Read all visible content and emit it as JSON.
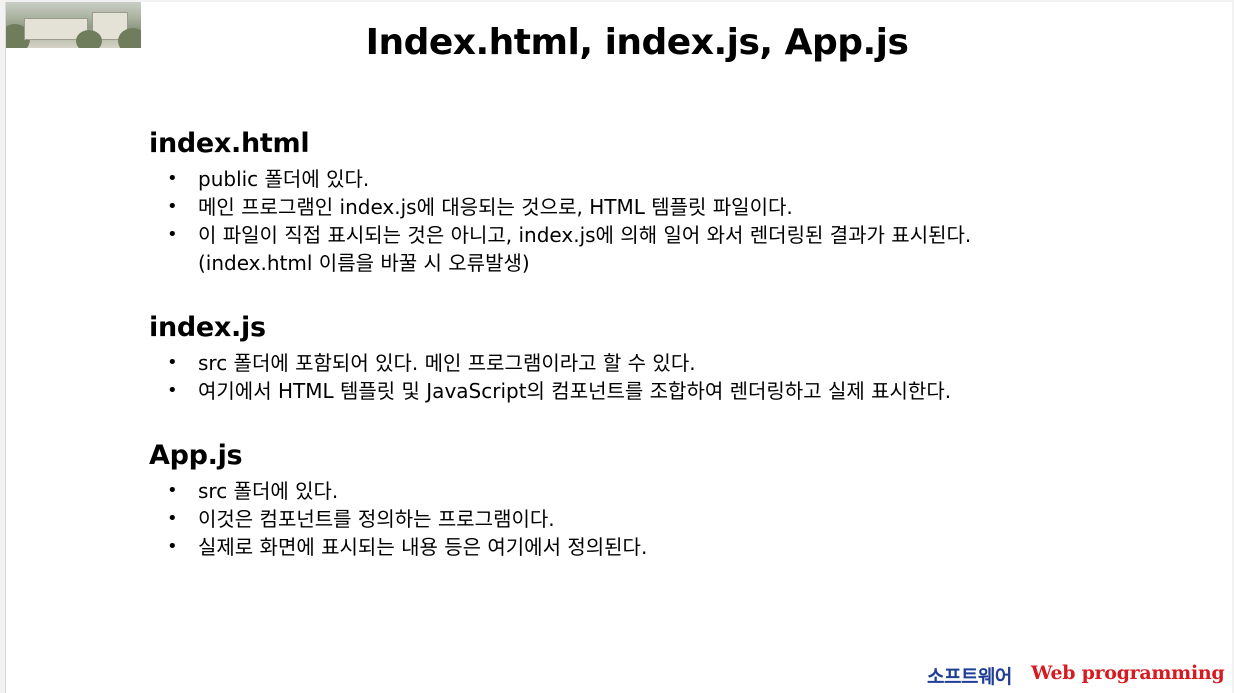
{
  "title": "Index.html, index.js, App.js",
  "sections": [
    {
      "heading": "index.html",
      "items": [
        "public 폴더에 있다.",
        "메인 프로그램인 index.js에 대응되는 것으로, HTML 템플릿 파일이다.",
        "이 파일이 직접 표시되는 것은 아니고, index.js에 의해 일어 와서 렌더링된 결과가 표시된다."
      ],
      "item3_continuation": "(index.html 이름을 바꿀 시 오류발생)"
    },
    {
      "heading": "index.js",
      "items": [
        "src 폴더에 포함되어 있다. 메인 프로그램이라고 할 수 있다.",
        "여기에서 HTML 템플릿 및 JavaScript의 컴포넌트를 조합하여 렌더링하고 실제 표시한다."
      ]
    },
    {
      "heading": "App.js",
      "items": [
        "src 폴더에 있다.",
        "이것은 컴포넌트를 정의하는 프로그램이다.",
        "실제로 화면에 표시되는 내용 등은 여기에서 정의된다."
      ]
    }
  ],
  "bullet": "•",
  "footer": {
    "korean": "소프트웨어",
    "english": "Web programming"
  },
  "colors": {
    "footer_korean": "#1f3f96",
    "footer_english": "#d71920"
  },
  "icons": {
    "top_left_image": "campus-building-photo"
  }
}
